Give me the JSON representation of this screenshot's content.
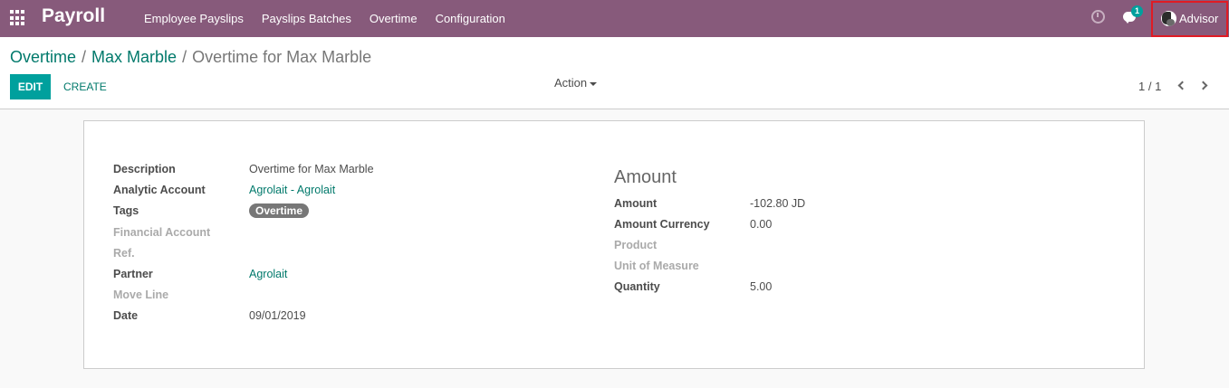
{
  "navbar": {
    "brand": "Payroll",
    "menu": [
      "Employee Payslips",
      "Payslips Batches",
      "Overtime",
      "Configuration"
    ],
    "chat_count": "1",
    "user": "Advisor"
  },
  "breadcrumb": {
    "items": [
      "Overtime",
      "Max Marble"
    ],
    "separator": "/",
    "current": "Overtime for Max Marble"
  },
  "buttons": {
    "edit": "EDIT",
    "create": "CREATE",
    "action": "Action"
  },
  "pager": {
    "value": "1 / 1"
  },
  "form": {
    "left": [
      {
        "label": "Description",
        "value": "Overtime for Max Marble",
        "muted": false
      },
      {
        "label": "Analytic Account",
        "value": "Agrolait - Agrolait",
        "muted": false
      },
      {
        "label": "Tags",
        "value": "Overtime",
        "muted": false
      },
      {
        "label": "Financial Account",
        "value": "",
        "muted": true
      },
      {
        "label": "Ref.",
        "value": "",
        "muted": true
      },
      {
        "label": "Partner",
        "value": "Agrolait",
        "muted": false
      },
      {
        "label": "Move Line",
        "value": "",
        "muted": true
      },
      {
        "label": "Date",
        "value": "09/01/2019",
        "muted": false
      }
    ],
    "amount_group_title": "Amount",
    "right": [
      {
        "label": "Amount",
        "value": "-102.80 JD",
        "muted": false
      },
      {
        "label": "Amount Currency",
        "value": "0.00",
        "muted": false
      },
      {
        "label": "Product",
        "value": "",
        "muted": true
      },
      {
        "label": "Unit of Measure",
        "value": "",
        "muted": true
      },
      {
        "label": "Quantity",
        "value": "5.00",
        "muted": false
      }
    ]
  },
  "colors": {
    "navbar": "#875a7b",
    "primary": "#00a09d",
    "link": "#00796b",
    "highlight_border": "#e01b24"
  }
}
